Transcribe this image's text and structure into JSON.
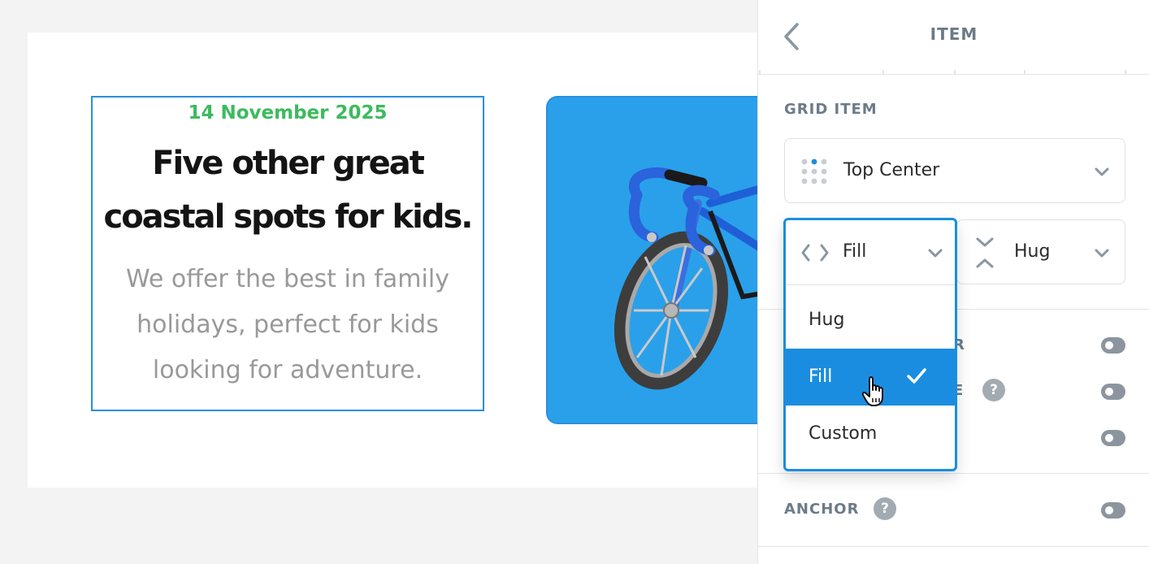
{
  "canvas": {
    "date": "14 November 2025",
    "headline": "Five other great\ncoastal spots for kids.",
    "body": "We offer the best in family\nholidays, perfect for kids\nlooking for adventure."
  },
  "panel": {
    "title": "ITEM",
    "grid_item_title": "GRID ITEM",
    "alignment_select": {
      "value": "Top Center"
    },
    "width_select": {
      "value": "Fill"
    },
    "height_select": {
      "value": "Hug"
    },
    "anchor_title": "ANCHOR",
    "partial_labels": [
      "R",
      "E"
    ]
  },
  "dropdown": {
    "options": [
      {
        "label": "Hug",
        "selected": false
      },
      {
        "label": "Fill",
        "selected": true
      },
      {
        "label": "Custom",
        "selected": false
      }
    ]
  },
  "help_glyph": "?",
  "colors": {
    "accent": "#1b8de0",
    "date_green": "#3dbb5e",
    "image_bg": "#2aa0ea"
  }
}
